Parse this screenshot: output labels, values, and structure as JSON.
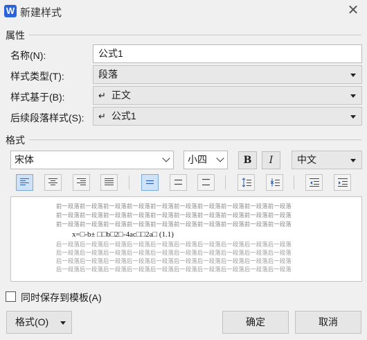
{
  "window": {
    "app_icon_letter": "W",
    "title": "新建样式",
    "close_symbol": "✕"
  },
  "properties": {
    "section_title": "属性",
    "name_label": "名称(N):",
    "name_value": "公式1",
    "type_label": "样式类型(T):",
    "type_value": "段落",
    "based_on_label": "样式基于(B):",
    "based_on_value": "正文",
    "next_style_label": "后续段落样式(S):",
    "next_style_value": "公式1",
    "enter_glyph": "↵"
  },
  "format": {
    "section_title": "格式",
    "font_name": "宋体",
    "font_size": "小四",
    "bold_label": "B",
    "italic_label": "I",
    "language": "中文"
  },
  "preview": {
    "before_lines": [
      "前一段落前一段落前一段落前一段落前一段落前一段落前一段落前一段落前一段落前一段落",
      "前一段落前一段落前一段落前一段落前一段落前一段落前一段落前一段落前一段落前一段落",
      "前一段落前一段落前一段落前一段落前一段落前一段落前一段落前一段落前一段落前一段落"
    ],
    "formula": "x=□-b± □□b□2□-4ac□□2a□ (1.1)",
    "after_lines": [
      "后一段落后一段落后一段落后一段落后一段落后一段落后一段落后一段落后一段落后一段落",
      "后一段落后一段落后一段落后一段落后一段落后一段落后一段落后一段落后一段落后一段落",
      "后一段落后一段落后一段落后一段落后一段落后一段落后一段落后一段落后一段落后一段落",
      "后一段落后一段落后一段落后一段落后一段落后一段落后一段落后一段落后一段落后一段落"
    ]
  },
  "footer": {
    "save_to_template_label": "同时保存到模板(A)",
    "format_menu_label": "格式(O)",
    "ok_label": "确定",
    "cancel_label": "取消"
  },
  "colors": {
    "accent": "#2c64d8",
    "active_button": "#cfe3f8"
  }
}
